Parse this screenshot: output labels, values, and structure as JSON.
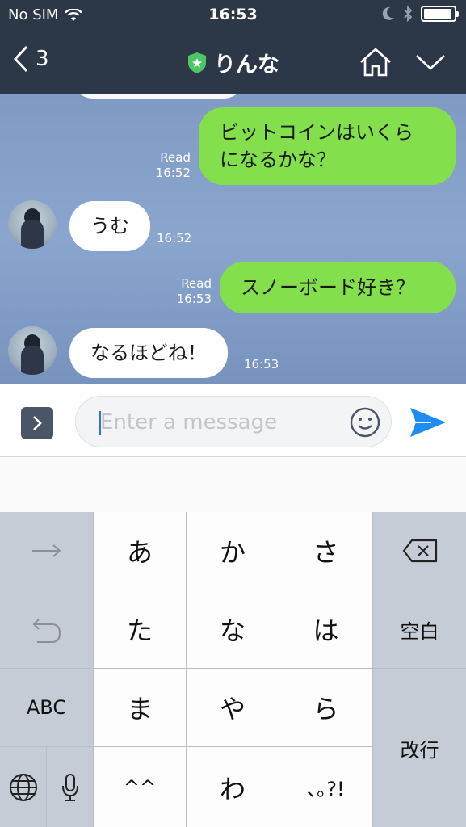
{
  "status_bar": {
    "carrier": "No SIM",
    "time": "16:53"
  },
  "header": {
    "back_count": "3",
    "title": "りんな"
  },
  "chat": {
    "messages": [
      {
        "dir": "out",
        "text_line1": "ビットコインはいくら",
        "text_line2": "になるかな？",
        "read": "Read",
        "time": "16:52"
      },
      {
        "dir": "in",
        "text": "うむ",
        "time": "16:52"
      },
      {
        "dir": "out",
        "text": "スノーボード好き？",
        "read": "Read",
        "time": "16:53"
      },
      {
        "dir": "in",
        "text": "なるほどね！",
        "time": "16:53"
      }
    ]
  },
  "input": {
    "placeholder": "Enter a message"
  },
  "keyboard": {
    "row1": [
      "あ",
      "か",
      "さ"
    ],
    "row2": [
      "た",
      "な",
      "は"
    ],
    "row3": [
      "ま",
      "や",
      "ら"
    ],
    "row4": [
      "^^",
      "わ",
      "､｡?!"
    ],
    "space_label": "空白",
    "return_label": "改行",
    "abc_label": "ABC"
  }
}
